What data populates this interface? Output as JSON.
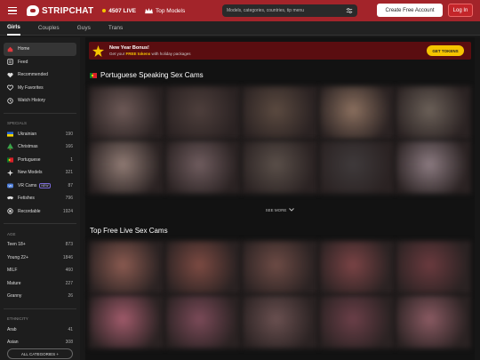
{
  "header": {
    "brand": "STRIPCHAT",
    "live_count": "4507 LIVE",
    "top_models": "Top Models",
    "search_placeholder": "Models, categories, countries, tip menu",
    "create_account": "Create Free Account",
    "login": "Log In"
  },
  "tabs": [
    "Girls",
    "Couples",
    "Guys",
    "Trans"
  ],
  "sidebar": {
    "nav": [
      {
        "label": "Home",
        "icon": "home-icon"
      },
      {
        "label": "Feed",
        "icon": "feed-icon"
      },
      {
        "label": "Recommended",
        "icon": "heart-icon"
      },
      {
        "label": "My Favorites",
        "icon": "favorites-icon"
      },
      {
        "label": "Watch History",
        "icon": "history-icon"
      }
    ],
    "specials_heading": "Specials",
    "specials": [
      {
        "label": "Ukrainian",
        "count": "190",
        "icon": "ukraine-flag-icon"
      },
      {
        "label": "Christmas",
        "count": "166",
        "icon": "christmas-tree-icon"
      },
      {
        "label": "Portuguese",
        "count": "1",
        "icon": "portugal-flag-icon"
      },
      {
        "label": "New Models",
        "count": "321",
        "icon": "new-models-icon"
      },
      {
        "label": "VR Cams",
        "count": "87",
        "icon": "vr-icon",
        "badge": "NEW"
      },
      {
        "label": "Fetishes",
        "count": "796",
        "icon": "fetish-icon"
      },
      {
        "label": "Recordable",
        "count": "1924",
        "icon": "record-icon"
      }
    ],
    "age_heading": "Age",
    "age": [
      {
        "label": "Teen 18+",
        "count": "873"
      },
      {
        "label": "Young 22+",
        "count": "1846"
      },
      {
        "label": "MILF",
        "count": "460"
      },
      {
        "label": "Mature",
        "count": "227"
      },
      {
        "label": "Granny",
        "count": "26"
      }
    ],
    "ethnicity_heading": "Ethnicity",
    "ethnicity": [
      {
        "label": "Arab",
        "count": "41"
      },
      {
        "label": "Asian",
        "count": "308"
      }
    ],
    "all_categories": "ALL CATEGORIES +"
  },
  "banner": {
    "title": "New Year Bonus!",
    "sub_prefix": "Get your ",
    "sub_highlight": "FREE tokens",
    "sub_suffix": " with holiday packages",
    "button": "GET TOKENS"
  },
  "sections": {
    "portuguese_title": "Portuguese Speaking Sex Cams",
    "see_more": "SEE MORE",
    "top_free_title": "Top Free Live Sex Cams"
  },
  "colors": {
    "brand_red": "#a3242a",
    "accent_yellow": "#f5c400"
  },
  "thumbs_portuguese": [
    "#6e5a57",
    "#4e3f3c",
    "#5b4a40",
    "#8a6f5e",
    "#6b6058",
    "#8f7a73",
    "#6f5c5e",
    "#5a4f49",
    "#3f3a3b",
    "#8b7a80"
  ],
  "thumbs_top": [
    "#8a5a50",
    "#7c4a42",
    "#6d4b45",
    "#7a4345",
    "#6a3a3e",
    "#a05a6a",
    "#7b4a58",
    "#6a5050",
    "#6b3f48",
    "#8a5a62"
  ]
}
